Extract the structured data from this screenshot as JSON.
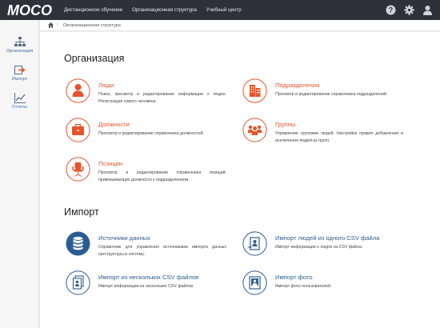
{
  "app": {
    "logo_text": "MOCO",
    "nav": [
      "Дистанционное обучение",
      "Организационная структура",
      "Учебный центр"
    ],
    "icons": [
      "help-icon",
      "gear-icon",
      "user-icon"
    ]
  },
  "sidebar": {
    "items": [
      {
        "label": "Организация",
        "icon": "org-chart-icon"
      },
      {
        "label": "Импорт",
        "icon": "import-icon"
      },
      {
        "label": "Отчеты",
        "icon": "reports-icon"
      }
    ]
  },
  "breadcrumb": {
    "sep": "/",
    "current": "Организационная структура"
  },
  "sections": {
    "org": {
      "title": "Организация",
      "cards": [
        {
          "title": "Люди",
          "desc": "Поиск, просмотр и редактирование информации о людях. Регистрация нового человека.",
          "icon": "person-icon"
        },
        {
          "title": "Подразделения",
          "desc": "Просмотр и редактирование справочника подразделений.",
          "icon": "building-icon"
        },
        {
          "title": "Должности",
          "desc": "Просмотр и редактирование справочника должностей.",
          "icon": "briefcase-icon"
        },
        {
          "title": "Группы",
          "desc": "Управление группами людей. Настройка правил добавления и исключения людей из групп.",
          "icon": "group-icon"
        },
        {
          "title": "Позиции",
          "desc": "Просмотр и редактирование справочника позиций, привязывающих должности к подразделениям.",
          "icon": "chair-icon"
        }
      ]
    },
    "import": {
      "title": "Импорт",
      "cards": [
        {
          "title": "Источники данных",
          "desc": "Справочник для управления источниками импорта данных оргструктуры в систему.",
          "icon": "database-icon"
        },
        {
          "title": "Импорт людей из одного CSV файла",
          "desc": "Импорт информации о людях из CSV файла.",
          "icon": "import-person-file-icon"
        },
        {
          "title": "Импорт из нескольких CSV файлов",
          "desc": "Импорт информации из нескольких CSV файлов.",
          "icon": "import-files-icon"
        },
        {
          "title": "Импорт фото",
          "desc": "Импорт фото пользователей.",
          "icon": "import-photo-icon"
        }
      ]
    }
  },
  "colors": {
    "orange": "#e5542a",
    "blue": "#2b5d93",
    "topbar": "#2e3238"
  }
}
